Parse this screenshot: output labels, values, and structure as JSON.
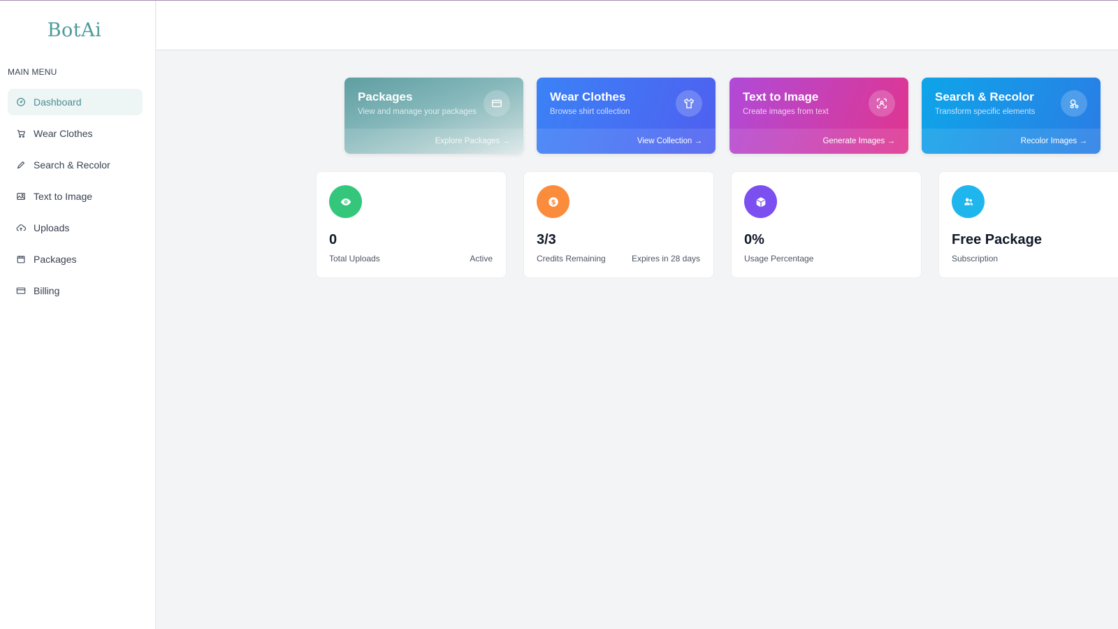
{
  "app": {
    "logo": "BotAi"
  },
  "sidebar": {
    "heading": "MAIN MENU",
    "items": [
      {
        "label": "Dashboard",
        "icon": "gauge-icon",
        "active": true
      },
      {
        "label": "Wear Clothes",
        "icon": "cart-icon"
      },
      {
        "label": "Search & Recolor",
        "icon": "pencil-icon"
      },
      {
        "label": "Text to Image",
        "icon": "image-icon"
      },
      {
        "label": "Uploads",
        "icon": "cloud-upload-icon"
      },
      {
        "label": "Packages",
        "icon": "package-icon"
      },
      {
        "label": "Billing",
        "icon": "credit-card-icon"
      }
    ]
  },
  "features": [
    {
      "title": "Packages",
      "subtitle": "View and manage your packages",
      "link": "Explore Packages →",
      "icon": "card-icon"
    },
    {
      "title": "Wear Clothes",
      "subtitle": "Browse shirt collection",
      "link": "View Collection →",
      "icon": "shirt-icon"
    },
    {
      "title": "Text to Image",
      "subtitle": "Create images from text",
      "link": "Generate Images →",
      "icon": "scan-face-icon"
    },
    {
      "title": "Search & Recolor",
      "subtitle": "Transform specific elements",
      "link": "Recolor Images →",
      "icon": "search-shapes-icon"
    }
  ],
  "stats": [
    {
      "value": "0",
      "label": "Total Uploads",
      "meta": "Active",
      "icon": "eye-icon",
      "color": "#34c77b"
    },
    {
      "value": "3/3",
      "label": "Credits Remaining",
      "meta": "Expires in 28 days",
      "icon": "dollar-icon",
      "color": "#fb8c3c"
    },
    {
      "value": "0%",
      "label": "Usage Percentage",
      "meta": "",
      "icon": "cube-icon",
      "color": "#7c4ff0"
    },
    {
      "value": "Free Package",
      "label": "Subscription",
      "meta": "",
      "icon": "users-icon",
      "color": "#1fb6ee"
    }
  ]
}
